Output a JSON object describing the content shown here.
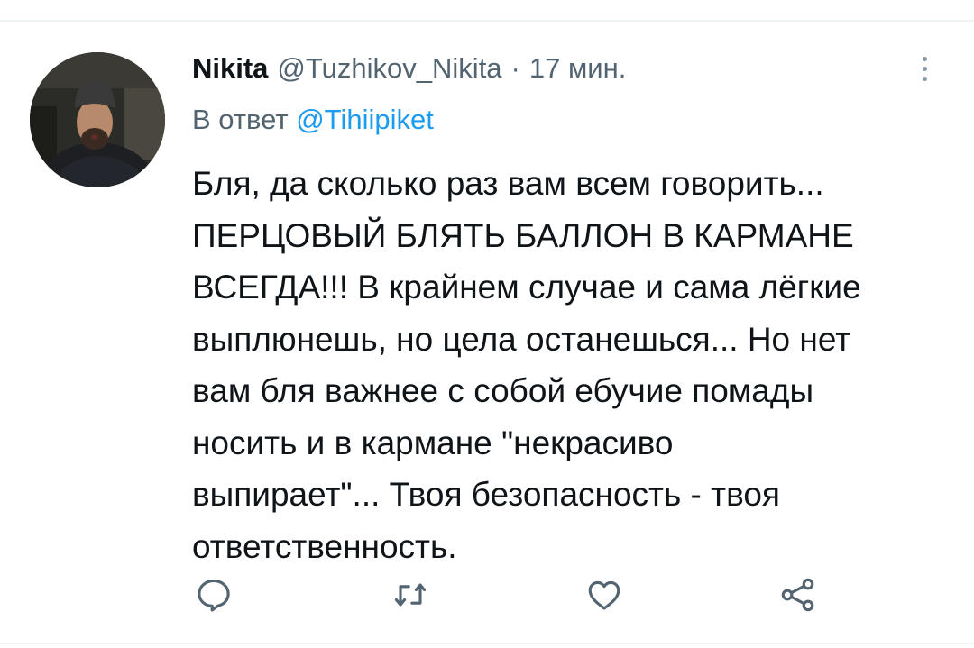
{
  "tweet": {
    "author": {
      "name": "Nikita",
      "handle": "@Tuzhikov_Nikita"
    },
    "separator": "·",
    "time": "17 мин.",
    "reply": {
      "prefix": "В ответ",
      "target": "@Tihiipiket"
    },
    "text": "Бля, да сколько раз вам всем говорить...\nПЕРЦОВЫЙ БЛЯТЬ БАЛЛОН В КАРМАНЕ\nВСЕГДА!!! В крайнем случае и сама лёгкие\nвыплюнешь, но цела останешься... Но нет\nвам бля важнее с собой ебучие помады\nносить и в кармане \"некрасиво\nвыпирает\"... Твоя безопасность - твоя\nответственность.",
    "actions": [
      {
        "name": "reply",
        "icon": "comment-icon"
      },
      {
        "name": "retweet",
        "icon": "retweet-icon"
      },
      {
        "name": "like",
        "icon": "heart-icon"
      },
      {
        "name": "share",
        "icon": "share-icon"
      }
    ]
  },
  "colors": {
    "text_primary": "#0f1419",
    "text_secondary": "#536471",
    "link": "#1d9bf0",
    "icon": "#536471",
    "divider": "#eff3f4"
  }
}
